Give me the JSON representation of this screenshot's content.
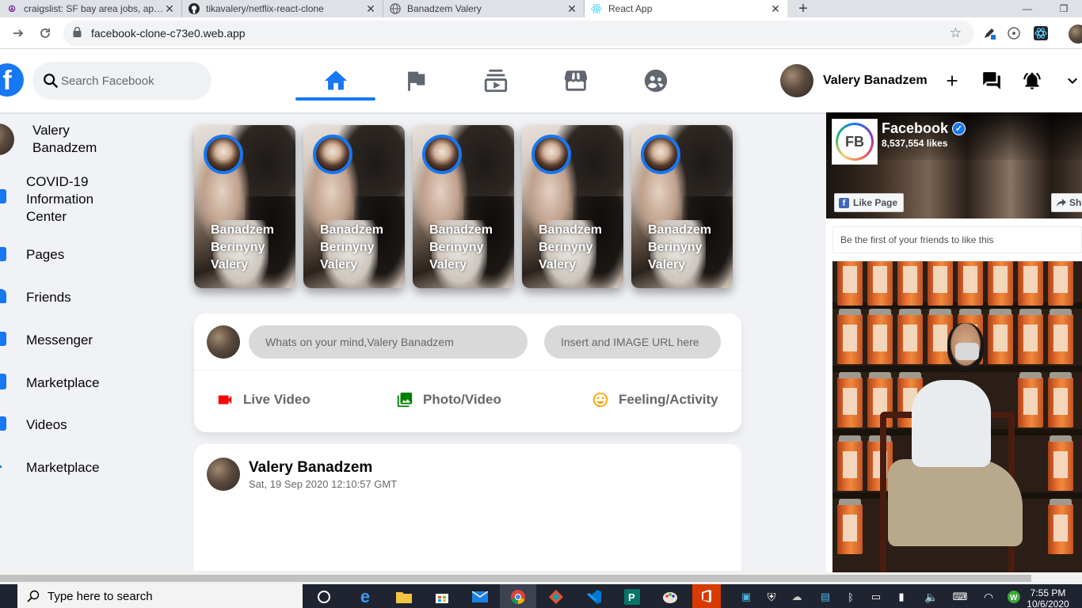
{
  "browser": {
    "tabs": [
      {
        "title": "craigslist: SF bay area jobs, apartments",
        "favicon": "craigslist-icon"
      },
      {
        "title": "tikavalery/netflix-react-clone",
        "favicon": "github-icon"
      },
      {
        "title": "Banadzem Valery",
        "favicon": "globe-icon"
      },
      {
        "title": "React App",
        "favicon": "react-icon"
      }
    ],
    "active_tab": 3,
    "url": "facebook-clone-c73e0.web.app"
  },
  "header": {
    "search_placeholder": "Search Facebook",
    "nav": [
      "home-icon",
      "flag-icon",
      "subscriptions-icon",
      "storefront-icon",
      "supervised-user-icon"
    ],
    "active_nav": "home-icon",
    "user_name": "Valery Banadzem",
    "accent_color": "#1877f2"
  },
  "sidebar": {
    "items": [
      {
        "label": "Valery Banadzem",
        "icon": "avatar"
      },
      {
        "label": "COVID-19 Information Center",
        "icon": "local-hospital-icon"
      },
      {
        "label": "Pages",
        "icon": "emoji-flags-icon"
      },
      {
        "label": "Friends",
        "icon": "people-icon"
      },
      {
        "label": "Messenger",
        "icon": "chat-icon"
      },
      {
        "label": "Marketplace",
        "icon": "storefront-icon"
      },
      {
        "label": "Videos",
        "icon": "video-library-icon"
      },
      {
        "label": "Marketplace",
        "icon": "expand-more-icon"
      }
    ]
  },
  "stories": [
    {
      "name": "Banadzem Berinyny Valery"
    },
    {
      "name": "Banadzem Berinyny Valery"
    },
    {
      "name": "Banadzem Berinyny Valery"
    },
    {
      "name": "Banadzem Berinyny Valery"
    },
    {
      "name": "Banadzem Berinyny Valery"
    }
  ],
  "message_sender": {
    "input_placeholder": "Whats on your mind,Valery Banadzem",
    "image_placeholder": "Insert and IMAGE URL here",
    "options": [
      {
        "label": "Live Video",
        "icon": "videocam-icon",
        "color": "#ff0000"
      },
      {
        "label": "Photo/Video",
        "icon": "photo-library-icon",
        "color": "#008000"
      },
      {
        "label": "Feeling/Activity",
        "icon": "insert-emoticon-icon",
        "color": "#ffa500"
      }
    ]
  },
  "post": {
    "username": "Valery Banadzem",
    "timestamp": "Sat, 19 Sep 2020 12:10:57 GMT"
  },
  "page_widget": {
    "page_name": "Facebook",
    "logo_text": "FB",
    "likes": "8,537,554 likes",
    "like_button": "Like Page",
    "share_button": "Share",
    "friends_text": "Be the first of your friends to like this"
  },
  "taskbar": {
    "search_placeholder": "Type here to search",
    "time": "7:55 PM",
    "date": "10/6/2020"
  }
}
